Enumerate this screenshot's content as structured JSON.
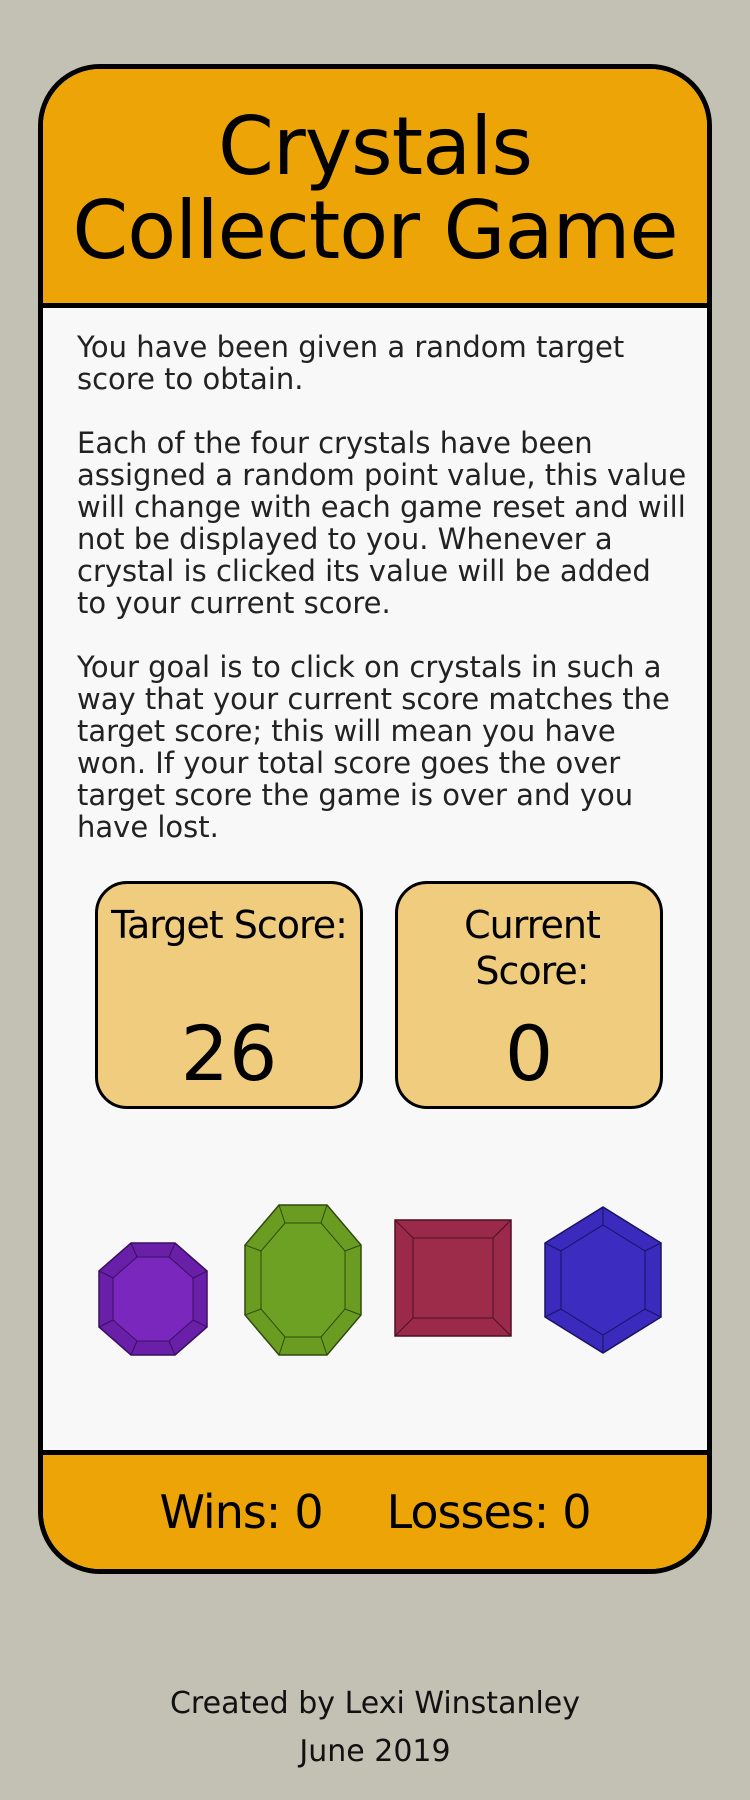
{
  "header": {
    "title": "Crystals Collector Game"
  },
  "instructions": [
    "You have been given a random target score to obtain.",
    "Each of the four crystals have been assigned a random point value, this value will change with each game reset and will not be displayed to you. Whenever a crystal is clicked its value will be added to your current score.",
    "Your goal is to click on crystals in such a way that your current score matches the target score; this will mean you have won. If your total score goes the over target score the game is over and you have lost."
  ],
  "scores": {
    "target_label": "Target Score:",
    "target_value": "26",
    "current_label": "Current Score:",
    "current_value": "0"
  },
  "crystals": [
    {
      "name": "purple-octagon-crystal",
      "color": "#6a1fa8"
    },
    {
      "name": "green-octagon-crystal",
      "color": "#6a9c22"
    },
    {
      "name": "red-square-crystal",
      "color": "#9b2a4a"
    },
    {
      "name": "blue-hexagon-crystal",
      "color": "#3a2bbd"
    }
  ],
  "footer": {
    "wins_label": "Wins:",
    "wins_value": "0",
    "losses_label": "Losses:",
    "losses_value": "0"
  },
  "credits": {
    "author": "Created by Lexi Winstanley",
    "date": "June 2019"
  }
}
